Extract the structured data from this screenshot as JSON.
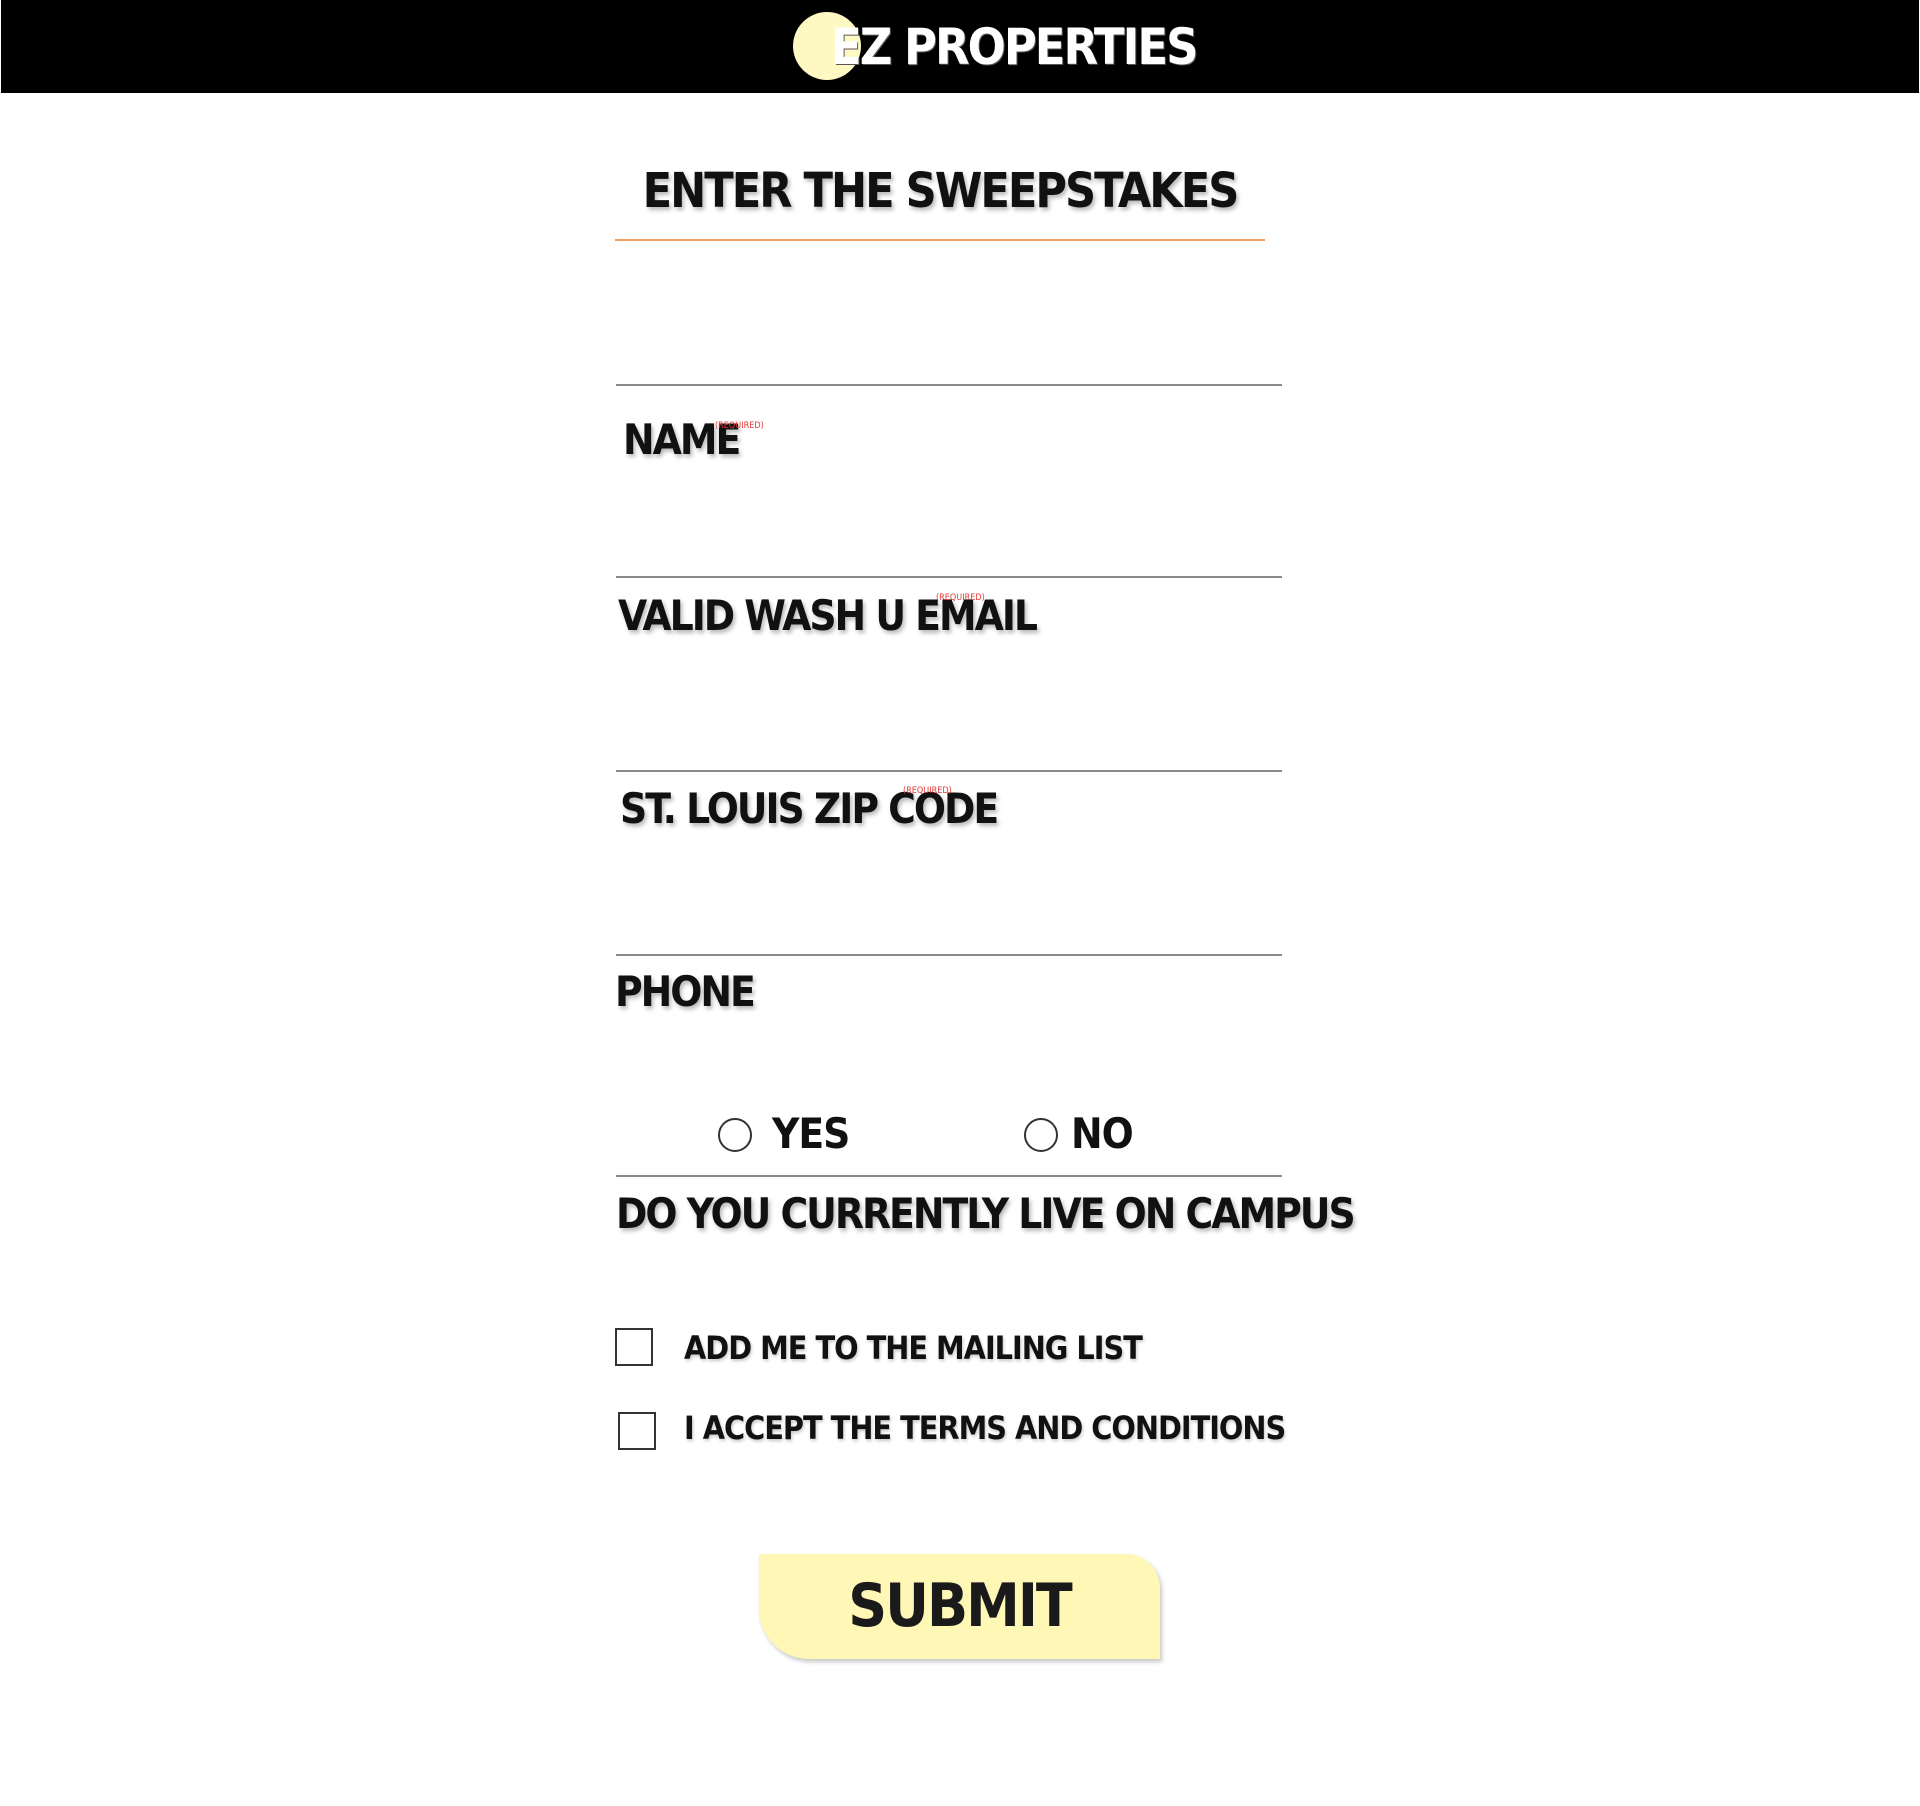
{
  "header": {
    "logo_text": "EZ PROPERTIES",
    "background_color": "#000000",
    "logo_circle_color": "#fef9c3"
  },
  "form": {
    "title": "ENTER THE SWEEPSTAKES",
    "title_rule_color": "#f2a05f",
    "fields": [
      {
        "label": "NAME",
        "required_text": "(REQUIRED)",
        "value": ""
      },
      {
        "label": "VALID WASH U EMAIL",
        "required_text": "(REQUIRED)",
        "value": ""
      },
      {
        "label": "ST. LOUIS ZIP CODE",
        "required_text": "(REQUIRED)",
        "value": ""
      },
      {
        "label": "PHONE",
        "value": ""
      }
    ],
    "campus_question": {
      "label": "DO YOU CURRENTLY LIVE ON CAMPUS",
      "options": [
        "YES",
        "NO"
      ],
      "selected": null
    },
    "checkboxes": [
      {
        "label": "ADD ME TO THE MAILING LIST",
        "checked": false
      },
      {
        "label": "I ACCEPT THE TERMS AND CONDITIONS",
        "checked": false
      }
    ],
    "submit_label": "SUBMIT",
    "submit_color": "#fef7b5",
    "required_color": "#e53935"
  }
}
